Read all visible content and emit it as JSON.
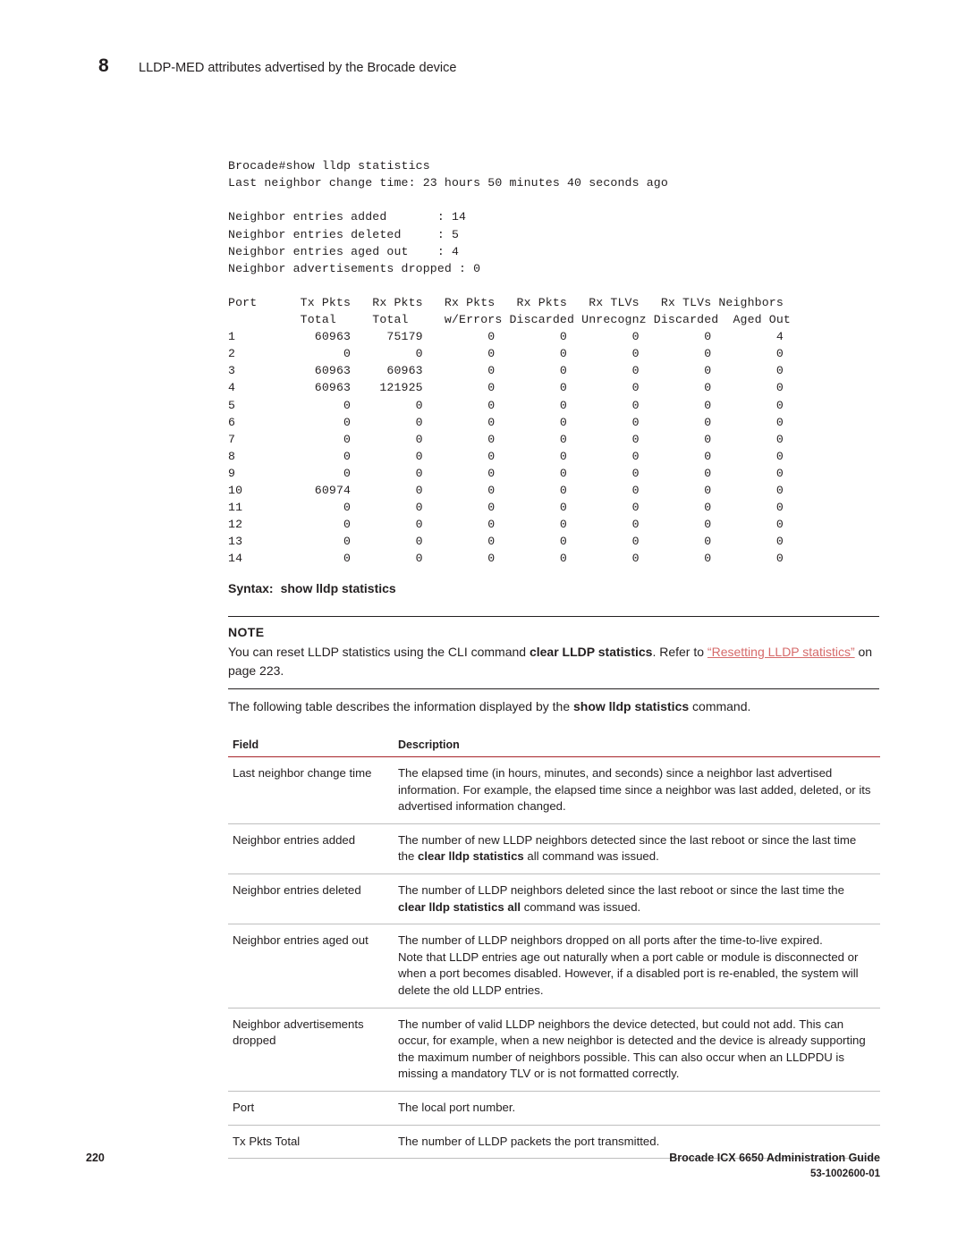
{
  "header": {
    "chapter_number": "8",
    "chapter_title": "LLDP-MED attributes advertised by the Brocade device"
  },
  "code_block": "Brocade#show lldp statistics\nLast neighbor change time: 23 hours 50 minutes 40 seconds ago\n\nNeighbor entries added       : 14\nNeighbor entries deleted     : 5\nNeighbor entries aged out    : 4\nNeighbor advertisements dropped : 0\n\nPort      Tx Pkts   Rx Pkts   Rx Pkts   Rx Pkts   Rx TLVs   Rx TLVs Neighbors\n          Total     Total     w/Errors Discarded Unrecognz Discarded  Aged Out\n1           60963     75179         0         0         0         0         4\n2               0         0         0         0         0         0         0\n3           60963     60963         0         0         0         0         0\n4           60963    121925         0         0         0         0         0\n5               0         0         0         0         0         0         0\n6               0         0         0         0         0         0         0\n7               0         0         0         0         0         0         0\n8               0         0         0         0         0         0         0\n9               0         0         0         0         0         0         0\n10          60974         0         0         0         0         0         0\n11              0         0         0         0         0         0         0\n12              0         0         0         0         0         0         0\n13              0         0         0         0         0         0         0\n14              0         0         0         0         0         0         0",
  "syntax": {
    "label": "Syntax:",
    "command": "show lldp statistics"
  },
  "note": {
    "title": "NOTE",
    "text_1": "You can reset LLDP statistics using the CLI command ",
    "bold_1": "clear LLDP statistics",
    "text_2": ".  Refer to ",
    "link": "“Resetting LLDP statistics”",
    "text_3": " on page 223."
  },
  "intro": {
    "text_1": "The following table describes the information displayed by the ",
    "bold_1": "show lldp statistics",
    "text_2": " command."
  },
  "table": {
    "headers": {
      "field": "Field",
      "description": "Description"
    },
    "rows": [
      {
        "field": "Last neighbor change time",
        "description": "The elapsed time (in hours, minutes, and seconds) since a neighbor last advertised information.  For example, the elapsed time since a neighbor was last added, deleted, or its advertised information changed."
      },
      {
        "field": "Neighbor entries added",
        "description_pre": "The number of new LLDP neighbors detected since the last reboot or since the last time the ",
        "description_bold": "clear lldp statistics",
        "description_post": " all command was issued."
      },
      {
        "field": "Neighbor entries deleted",
        "description_pre": "The number of LLDP neighbors deleted since the last reboot or since the last time the ",
        "description_bold": "clear lldp statistics all",
        "description_post": " command was issued."
      },
      {
        "field": "Neighbor entries aged out",
        "description": "The number of LLDP neighbors dropped on all ports after the time-to-live expired.\nNote that LLDP entries age out naturally when a port cable or module is disconnected or when a port becomes disabled.  However, if a disabled port is re-enabled, the system will delete the old LLDP entries."
      },
      {
        "field": "Neighbor advertisements dropped",
        "description": "The number of valid LLDP neighbors the device detected, but could not add.  This can occur, for example, when a new neighbor is detected and the device is already supporting the maximum number of neighbors possible.  This can also occur when an LLDPDU is missing a mandatory TLV or is not formatted correctly."
      },
      {
        "field": "Port",
        "description": "The local port number."
      },
      {
        "field": "Tx Pkts Total",
        "description": "The number of LLDP packets the port transmitted."
      }
    ]
  },
  "footer": {
    "page_number": "220",
    "guide_title": "Brocade ICX 6650 Administration Guide",
    "doc_number": "53-1002600-01"
  },
  "colors": {
    "accent_rule": "#a8242a",
    "link": "#d66a6a",
    "text": "#231f20"
  }
}
